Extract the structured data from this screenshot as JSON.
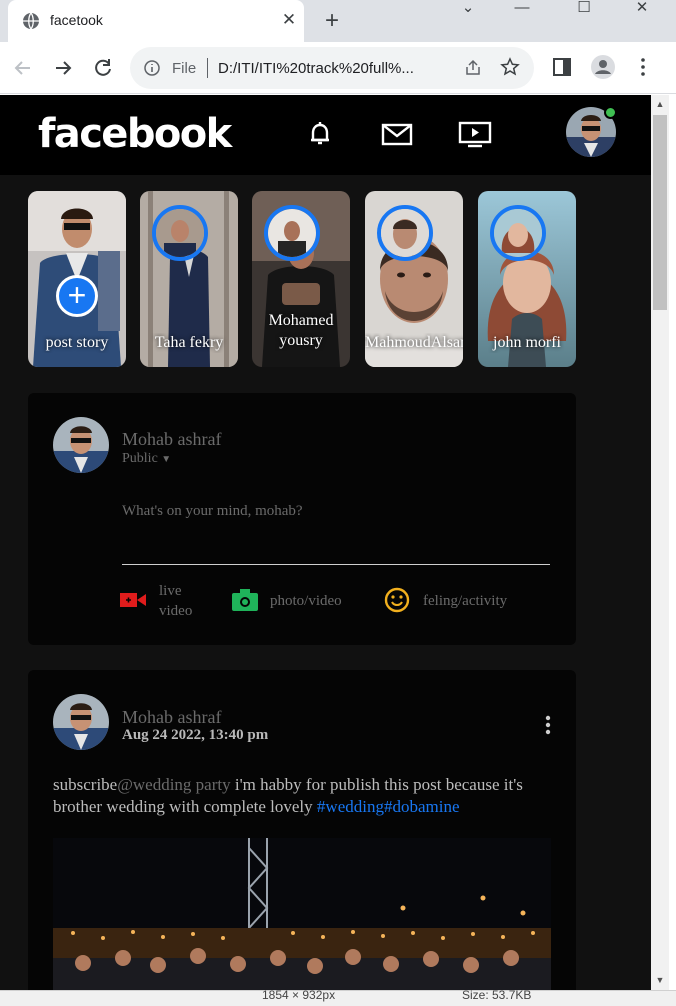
{
  "browser": {
    "tab_title": "facetook",
    "omnibox_scheme": "File",
    "omnibox_url": "D:/ITI/ITI%20track%20full%..."
  },
  "header": {
    "logo": "facebook",
    "icons": [
      "bell-icon",
      "mail-icon",
      "video-icon"
    ],
    "online_color": "#3fbf52"
  },
  "stories": [
    {
      "name": "post story",
      "is_add": true
    },
    {
      "name": "Taha fekry"
    },
    {
      "name": "Mohamed yousry"
    },
    {
      "name": "MahmoudAlsan"
    },
    {
      "name": "john morfi"
    }
  ],
  "composer": {
    "author": "Mohab ashraf",
    "audience": "Public",
    "placeholder": "What's on your mind, mohab?",
    "actions": [
      {
        "label": "live video",
        "icon": "live-video-icon",
        "color": "#e01c1c"
      },
      {
        "label": "photo/video",
        "icon": "camera-icon",
        "color": "#1fb35a"
      },
      {
        "label": "feling/activity",
        "icon": "smile-icon",
        "color": "#f2b01e"
      }
    ]
  },
  "post": {
    "author": "Mohab ashraf",
    "date": "Aug 24 2022, 13:40 pm",
    "text_prefix": "subscribe",
    "mention": "@wedding party",
    "text_body": " i'm habby for publish this post because it's brother wedding with complete lovely ",
    "hashtags": "#wedding#dobamine"
  },
  "statusbar": {
    "dimensions": "1854 × 932px",
    "size": "Size: 53.7KB"
  },
  "colors": {
    "accent": "#1877f2",
    "page_bg": "#111111",
    "card_bg": "#050505"
  }
}
